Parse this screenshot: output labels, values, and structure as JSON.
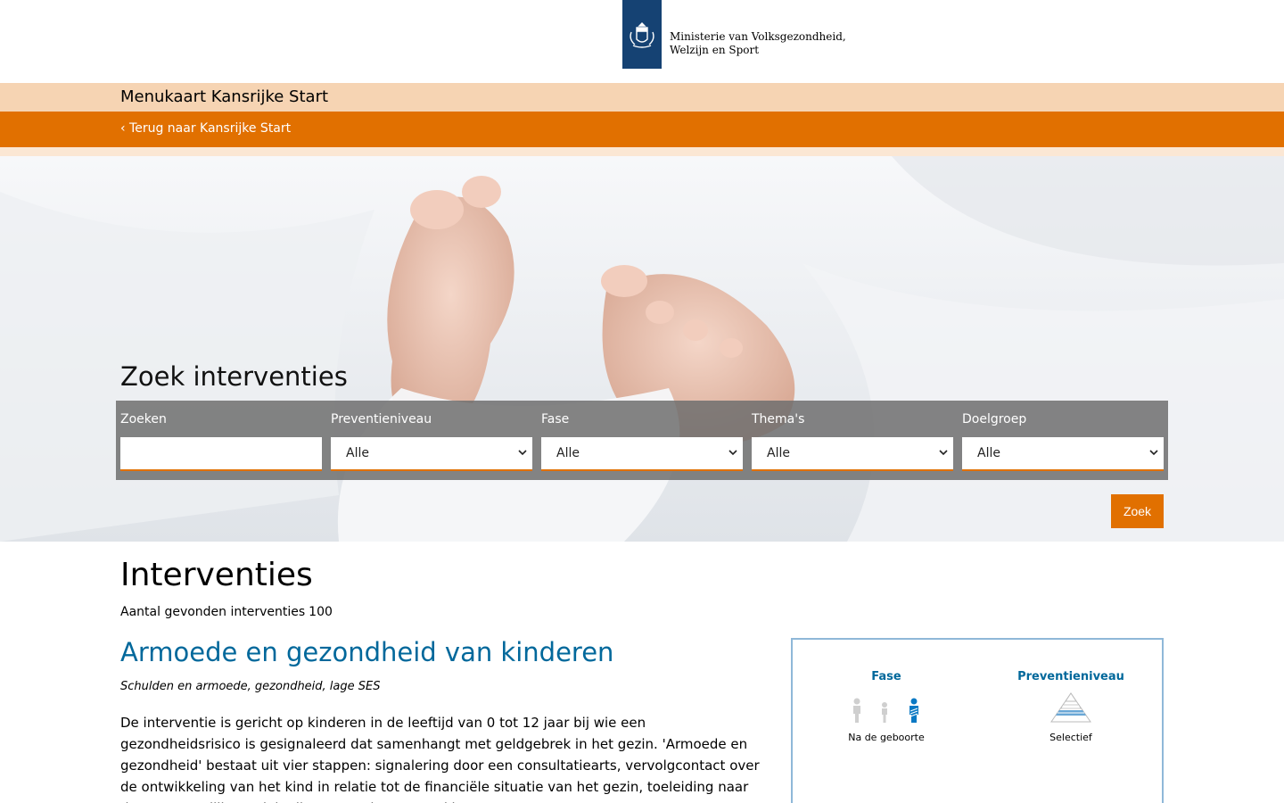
{
  "header": {
    "ministry_line1": "Ministerie van Volksgezondheid,",
    "ministry_line2": "Welzijn en Sport"
  },
  "subheader": {
    "title": "Menukaart Kansrijke Start"
  },
  "nav": {
    "back_link": "‹ Terug naar Kansrijke Start"
  },
  "hero": {
    "title": "Zoek interventies",
    "filters": [
      {
        "label": "Zoeken",
        "type": "text",
        "value": ""
      },
      {
        "label": "Preventieniveau",
        "type": "select",
        "value": "Alle"
      },
      {
        "label": "Fase",
        "type": "select",
        "value": "Alle"
      },
      {
        "label": "Thema's",
        "type": "select",
        "value": "Alle"
      },
      {
        "label": "Doelgroep",
        "type": "select",
        "value": "Alle"
      }
    ],
    "search_button": "Zoek"
  },
  "results": {
    "title": "Interventies",
    "count_label": "Aantal gevonden interventies",
    "count_value": "100",
    "items": [
      {
        "title": "Armoede en gezondheid van kinderen",
        "tags": "Schulden en armoede, gezondheid, lage SES",
        "description": "De interventie is gericht op kinderen in de leeftijd van 0 tot 12 jaar bij wie een gezondheidsrisico is gesignaleerd dat samenhangt met geldgebrek in het gezin. 'Armoede en gezondheid' bestaat uit vier stappen: signalering door een consultatiearts, vervolgcontact over de ontwikkeling van het kind in relatie tot de financiële situatie van het gezin, toeleiding naar de gemeentelijke sociale dienst voor het verstrekken van",
        "info": {
          "fase_heading": "Fase",
          "fase_value": "Na de geboorte",
          "preventie_heading": "Preventieniveau",
          "preventie_value": "Selectief"
        }
      }
    ]
  },
  "colors": {
    "brand_orange": "#e17000",
    "subheader_bg": "#f6d4b3",
    "logo_blue": "#154273",
    "link_blue": "#01689b"
  }
}
